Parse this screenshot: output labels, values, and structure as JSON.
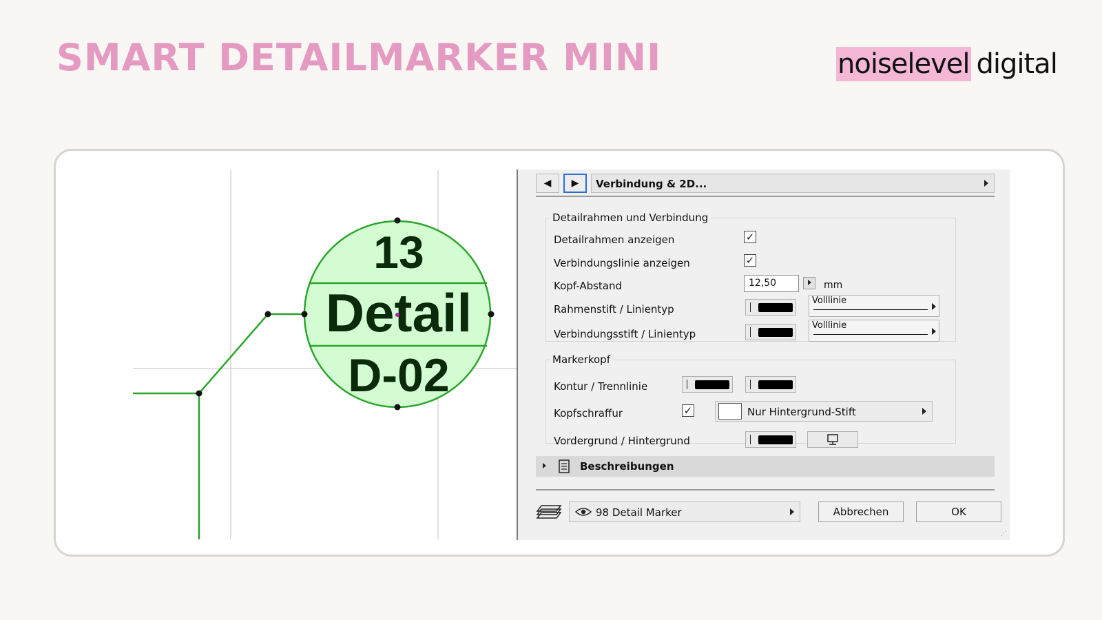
{
  "header": {
    "title": "SMART DETAILMARKER MINI"
  },
  "logo": {
    "part1": "noiselevel",
    "part2": "digital"
  },
  "marker": {
    "number": "13",
    "name": "Detail",
    "code": "D-02"
  },
  "colors": {
    "accent": "#e59ac2",
    "marker_fill": "#d4fcd2",
    "marker_stroke": "#2aa52a",
    "logo_highlight": "#f4b8d6"
  },
  "dialog": {
    "panel_title": "Verbindung & 2D...",
    "group1": {
      "title": "Detailrahmen und Verbindung",
      "show_frame_label": "Detailrahmen anzeigen",
      "show_frame_checked": "✓",
      "show_line_label": "Verbindungslinie anzeigen",
      "show_line_checked": "✓",
      "head_offset_label": "Kopf-Abstand",
      "head_offset_value": "12,50",
      "head_offset_unit": "mm",
      "frame_pen_label": "Rahmenstift / Linientyp",
      "frame_linetype": "Volllinie",
      "conn_pen_label": "Verbindungsstift / Linientyp",
      "conn_linetype": "Volllinie"
    },
    "group2": {
      "title": "Markerkopf",
      "contour_label": "Kontur / Trennlinie",
      "hatch_label": "Kopfschraffur",
      "hatch_checked": "✓",
      "hatch_option": "Nur Hintergrund-Stift",
      "fg_bg_label": "Vordergrund / Hintergrund"
    },
    "descriptions_label": "Beschreibungen",
    "layer_label": "98 Detail Marker",
    "cancel_label": "Abbrechen",
    "ok_label": "OK"
  }
}
